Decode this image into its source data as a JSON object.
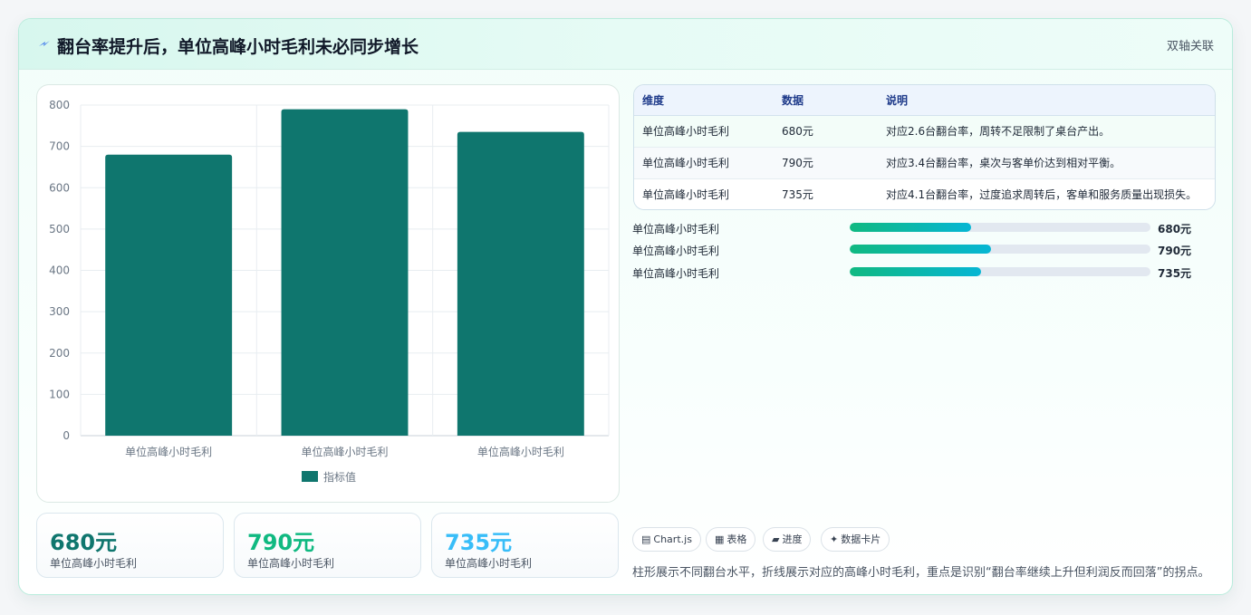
{
  "header": {
    "title": "翻台率提升后，单位高峰小时毛利未必同步增长",
    "tag": "双轴关联",
    "icon": "lightning-icon"
  },
  "chart_data": {
    "type": "bar",
    "categories": [
      "单位高峰小时毛利",
      "单位高峰小时毛利",
      "单位高峰小时毛利"
    ],
    "series": [
      {
        "name": "指标值",
        "values": [
          680,
          790,
          735
        ],
        "color": "#0f766e"
      }
    ],
    "ylim": [
      0,
      800
    ],
    "yticks": [
      0,
      100,
      200,
      300,
      400,
      500,
      600,
      700,
      800
    ],
    "grid": true,
    "legend": "bottom"
  },
  "kpis": [
    {
      "value": "680元",
      "label": "单位高峰小时毛利",
      "color": "#0f766e"
    },
    {
      "value": "790元",
      "label": "单位高峰小时毛利",
      "color": "#10b981"
    },
    {
      "value": "735元",
      "label": "单位高峰小时毛利",
      "color": "#38bdf8"
    }
  ],
  "table": {
    "headers": [
      "维度",
      "数据",
      "说明"
    ],
    "rows": [
      [
        "单位高峰小时毛利",
        "680元",
        "对应2.6台翻台率，周转不足限制了桌台产出。"
      ],
      [
        "单位高峰小时毛利",
        "790元",
        "对应3.4台翻台率，桌次与客单价达到相对平衡。"
      ],
      [
        "单位高峰小时毛利",
        "735元",
        "对应4.1台翻台率，过度追求周转后，客单和服务质量出现损失。"
      ]
    ]
  },
  "progress": [
    {
      "label": "单位高峰小时毛利",
      "value_text": "680元",
      "fraction": 0.405
    },
    {
      "label": "单位高峰小时毛利",
      "value_text": "790元",
      "fraction": 0.47
    },
    {
      "label": "单位高峰小时毛利",
      "value_text": "735元",
      "fraction": 0.437
    }
  ],
  "chips": [
    {
      "icon": "▤",
      "label": "Chart.js"
    },
    {
      "icon": "▦",
      "label": "表格"
    },
    {
      "icon": "▰",
      "label": "进度"
    },
    {
      "icon": "✦",
      "label": "数据卡片"
    }
  ],
  "note": "柱形展示不同翻台水平，折线展示对应的高峰小时毛利，重点是识别“翻台率继续上升但利润反而回落”的拐点。"
}
